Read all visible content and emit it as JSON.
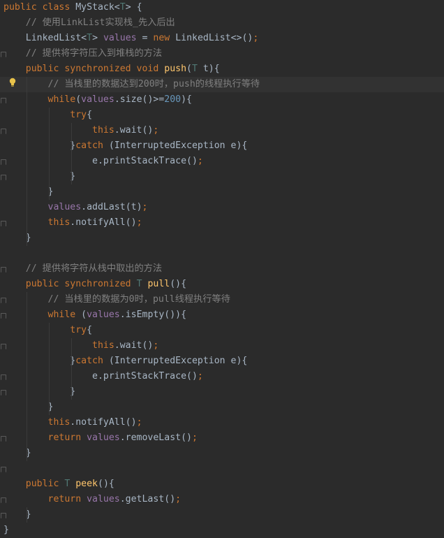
{
  "lines": [
    {
      "tokens": [
        {
          "t": "public class ",
          "c": "kw"
        },
        {
          "t": "MyStack",
          "c": "pl"
        },
        {
          "t": "<",
          "c": "pl"
        },
        {
          "t": "T",
          "c": "tp"
        },
        {
          "t": "> {",
          "c": "pl"
        }
      ]
    },
    {
      "tokens": [
        {
          "t": "    // 使用LinkList实现栈_先入后出",
          "c": "cm"
        }
      ]
    },
    {
      "tokens": [
        {
          "t": "    LinkedList",
          "c": "pl"
        },
        {
          "t": "<",
          "c": "pl"
        },
        {
          "t": "T",
          "c": "tp"
        },
        {
          "t": "> ",
          "c": "pl"
        },
        {
          "t": "values",
          "c": "field"
        },
        {
          "t": " = ",
          "c": "pl"
        },
        {
          "t": "new ",
          "c": "kw"
        },
        {
          "t": "LinkedList<>()",
          "c": "pl"
        },
        {
          "t": ";",
          "c": "kw"
        }
      ]
    },
    {
      "tokens": [
        {
          "t": "    // 提供将字符压入到堆栈的方法",
          "c": "cm"
        }
      ]
    },
    {
      "tokens": [
        {
          "t": "    public synchronized void ",
          "c": "kw"
        },
        {
          "t": "push",
          "c": "fn"
        },
        {
          "t": "(",
          "c": "pl"
        },
        {
          "t": "T",
          "c": "tp"
        },
        {
          "t": " t){",
          "c": "pl"
        }
      ]
    },
    {
      "tokens": [
        {
          "t": "        // 当栈里的数据达到200时，push的线程执行等待",
          "c": "cm"
        }
      ],
      "highlight": true
    },
    {
      "tokens": [
        {
          "t": "        while",
          "c": "kw"
        },
        {
          "t": "(",
          "c": "pl"
        },
        {
          "t": "values",
          "c": "field"
        },
        {
          "t": ".size()>=",
          "c": "pl"
        },
        {
          "t": "200",
          "c": "num"
        },
        {
          "t": "){",
          "c": "pl"
        }
      ]
    },
    {
      "tokens": [
        {
          "t": "            try",
          "c": "kw"
        },
        {
          "t": "{",
          "c": "pl"
        }
      ]
    },
    {
      "tokens": [
        {
          "t": "                this",
          "c": "kw"
        },
        {
          "t": ".wait()",
          "c": "pl"
        },
        {
          "t": ";",
          "c": "kw"
        }
      ]
    },
    {
      "tokens": [
        {
          "t": "            }",
          "c": "pl"
        },
        {
          "t": "catch ",
          "c": "kw"
        },
        {
          "t": "(InterruptedException e){",
          "c": "pl"
        }
      ]
    },
    {
      "tokens": [
        {
          "t": "                e.printStackTrace()",
          "c": "pl"
        },
        {
          "t": ";",
          "c": "kw"
        }
      ]
    },
    {
      "tokens": [
        {
          "t": "            }",
          "c": "pl"
        }
      ]
    },
    {
      "tokens": [
        {
          "t": "        }",
          "c": "pl"
        }
      ]
    },
    {
      "tokens": [
        {
          "t": "        ",
          "c": "pl"
        },
        {
          "t": "values",
          "c": "field"
        },
        {
          "t": ".addLast(t)",
          "c": "pl"
        },
        {
          "t": ";",
          "c": "kw"
        }
      ]
    },
    {
      "tokens": [
        {
          "t": "        this",
          "c": "kw"
        },
        {
          "t": ".notifyAll()",
          "c": "pl"
        },
        {
          "t": ";",
          "c": "kw"
        }
      ]
    },
    {
      "tokens": [
        {
          "t": "    }",
          "c": "pl"
        }
      ]
    },
    {
      "tokens": [
        {
          "t": "",
          "c": "pl"
        }
      ]
    },
    {
      "tokens": [
        {
          "t": "    // 提供将字符从栈中取出的方法",
          "c": "cm"
        }
      ]
    },
    {
      "tokens": [
        {
          "t": "    public synchronized ",
          "c": "kw"
        },
        {
          "t": "T ",
          "c": "tp"
        },
        {
          "t": "pull",
          "c": "fn"
        },
        {
          "t": "(){",
          "c": "pl"
        }
      ]
    },
    {
      "tokens": [
        {
          "t": "        // 当栈里的数据为0时，pull线程执行等待",
          "c": "cm"
        }
      ]
    },
    {
      "tokens": [
        {
          "t": "        while ",
          "c": "kw"
        },
        {
          "t": "(",
          "c": "pl"
        },
        {
          "t": "values",
          "c": "field"
        },
        {
          "t": ".isEmpty()){",
          "c": "pl"
        }
      ]
    },
    {
      "tokens": [
        {
          "t": "            try",
          "c": "kw"
        },
        {
          "t": "{",
          "c": "pl"
        }
      ]
    },
    {
      "tokens": [
        {
          "t": "                this",
          "c": "kw"
        },
        {
          "t": ".wait()",
          "c": "pl"
        },
        {
          "t": ";",
          "c": "kw"
        }
      ]
    },
    {
      "tokens": [
        {
          "t": "            }",
          "c": "pl"
        },
        {
          "t": "catch ",
          "c": "kw"
        },
        {
          "t": "(InterruptedException e){",
          "c": "pl"
        }
      ]
    },
    {
      "tokens": [
        {
          "t": "                e.printStackTrace()",
          "c": "pl"
        },
        {
          "t": ";",
          "c": "kw"
        }
      ]
    },
    {
      "tokens": [
        {
          "t": "            }",
          "c": "pl"
        }
      ]
    },
    {
      "tokens": [
        {
          "t": "        }",
          "c": "pl"
        }
      ]
    },
    {
      "tokens": [
        {
          "t": "        this",
          "c": "kw"
        },
        {
          "t": ".notifyAll()",
          "c": "pl"
        },
        {
          "t": ";",
          "c": "kw"
        }
      ]
    },
    {
      "tokens": [
        {
          "t": "        return ",
          "c": "kw"
        },
        {
          "t": "values",
          "c": "field"
        },
        {
          "t": ".removeLast()",
          "c": "pl"
        },
        {
          "t": ";",
          "c": "kw"
        }
      ]
    },
    {
      "tokens": [
        {
          "t": "    }",
          "c": "pl"
        }
      ]
    },
    {
      "tokens": [
        {
          "t": "",
          "c": "pl"
        }
      ]
    },
    {
      "tokens": [
        {
          "t": "    public ",
          "c": "kw"
        },
        {
          "t": "T ",
          "c": "tp"
        },
        {
          "t": "peek",
          "c": "fn"
        },
        {
          "t": "(){",
          "c": "pl"
        }
      ]
    },
    {
      "tokens": [
        {
          "t": "        return ",
          "c": "kw"
        },
        {
          "t": "values",
          "c": "field"
        },
        {
          "t": ".getLast()",
          "c": "pl"
        },
        {
          "t": ";",
          "c": "kw"
        }
      ]
    },
    {
      "tokens": [
        {
          "t": "    }",
          "c": "pl"
        }
      ]
    },
    {
      "tokens": [
        {
          "t": "}",
          "c": "pl"
        }
      ]
    }
  ],
  "folds": [
    4,
    6,
    7,
    9,
    11,
    12,
    15,
    18,
    20,
    21,
    23,
    25,
    26,
    29,
    31,
    33,
    34
  ],
  "intention_icon": "lightbulb-icon",
  "colors": {
    "background": "#2b2b2b",
    "keyword": "#cc7832",
    "comment": "#808080",
    "field": "#9876aa",
    "number": "#6897bb",
    "method": "#ffc66d",
    "type_param": "#507874",
    "text": "#a9b7c6",
    "bulb": "#e8c24a"
  }
}
